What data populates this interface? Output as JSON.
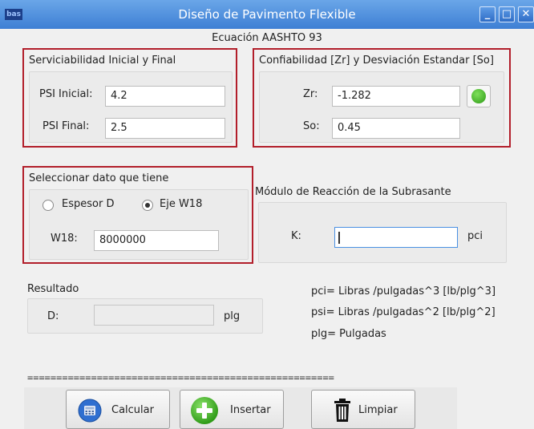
{
  "window": {
    "app_icon_text": "bas",
    "title": "Diseño de Pavimento Flexible",
    "minimize_glyph": "_",
    "maximize_glyph": "□",
    "close_glyph": "✕"
  },
  "subtitle": "Ecuación AASHTO 93",
  "serviceability": {
    "title": "Serviciabilidad Inicial y Final",
    "psi_initial_label": "PSI Inicial:",
    "psi_initial_value": "4.2",
    "psi_final_label": "PSI Final:",
    "psi_final_value": "2.5"
  },
  "reliability": {
    "title": "Confiabilidad [Zr] y Desviación Estandar [So]",
    "zr_label": "Zr:",
    "zr_value": "-1.282",
    "so_label": "So:",
    "so_value": "0.45"
  },
  "data_select": {
    "title": "Seleccionar  dato que tiene",
    "option_thickness": "Espesor D",
    "option_axle": "Eje W18",
    "selected": "Eje W18",
    "w18_label": "W18:",
    "w18_value": "8000000"
  },
  "subgrade": {
    "title": "Módulo de Reacción de la Subrasante",
    "k_label": "K:",
    "k_value": "",
    "k_unit": "pci"
  },
  "result": {
    "title": "Resultado",
    "d_label": "D:",
    "d_value": "",
    "d_unit": "plg"
  },
  "legend": {
    "line1": "pci= Libras /pulgadas^3 [lb/plg^3]",
    "line2": "psi= Libras /pulgadas^2 [lb/plg^2]",
    "line3": "plg= Pulgadas"
  },
  "separator": "=====================================================",
  "buttons": {
    "calculate": "Calcular",
    "insert": "Insertar",
    "clear": "Limpiar"
  },
  "colors": {
    "highlight_border": "#b21e2a",
    "titlebar": "#3e7fd4",
    "plus_icon": "#2e9a17"
  }
}
